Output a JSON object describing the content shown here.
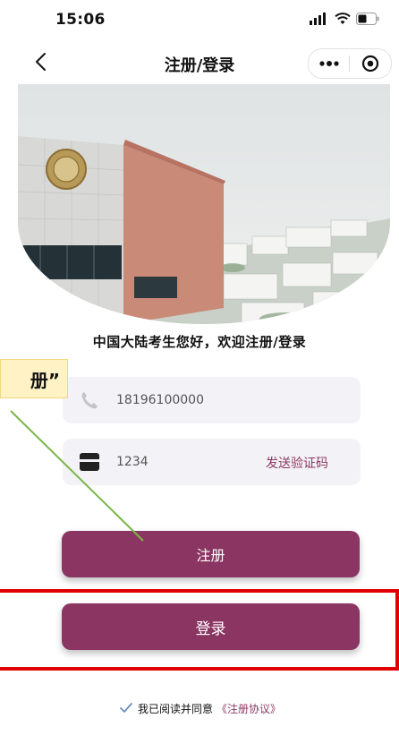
{
  "status_bar": {
    "time": "15:06"
  },
  "nav": {
    "title": "注册/登录"
  },
  "welcome": "中国大陆考生您好，欢迎注册/登录",
  "form": {
    "phone_value": "18196100000",
    "code_value": "1234",
    "send_code_label": "发送验证码"
  },
  "buttons": {
    "register_label": "注册",
    "login_label": "登录"
  },
  "agreement": {
    "text": "我已阅读并同意",
    "link": "《注册协议》"
  },
  "annotation": {
    "callout_text": "册”"
  },
  "colors": {
    "brand": "#8b3562",
    "link": "#8c3a64",
    "field_bg": "#f3f2f6",
    "highlight": "#e00000",
    "arrow": "#7ab648",
    "callout_bg": "#fff2c4"
  }
}
